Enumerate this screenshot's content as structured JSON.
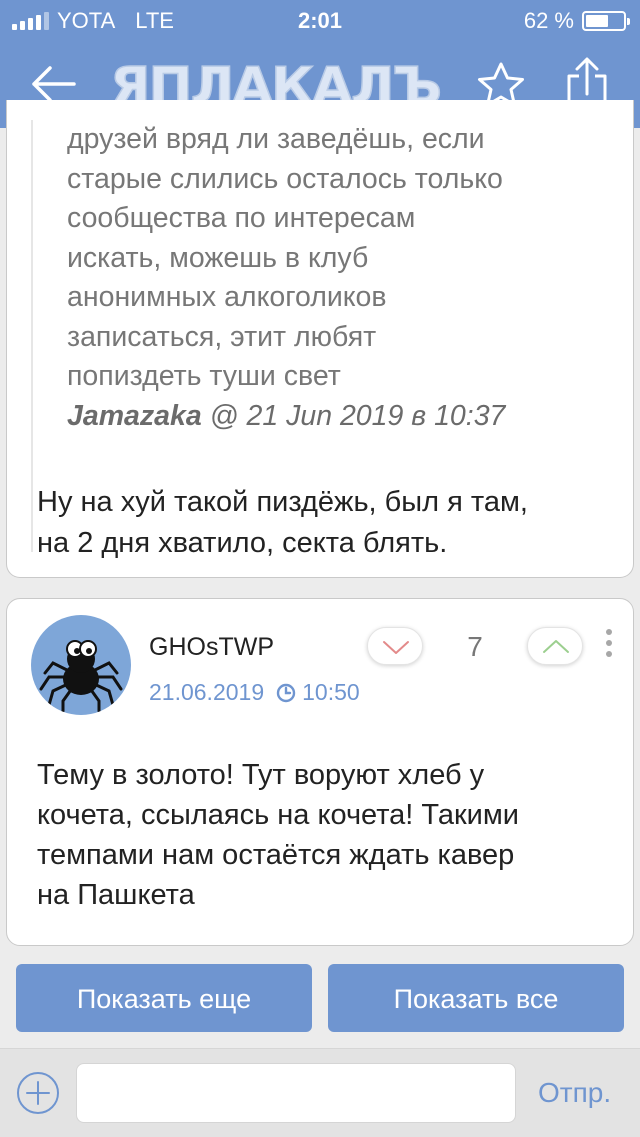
{
  "status_bar": {
    "carrier": "YOTA",
    "network": "LTE",
    "time": "2:01",
    "battery_text": "62 %",
    "battery_level": 0.62
  },
  "nav": {
    "logo_text": "ЯПЛАКАЛЪ",
    "icons": [
      "back-arrow-icon",
      "star-icon",
      "share-icon"
    ]
  },
  "post1": {
    "quote_lines": [
      "друзей вряд ли заведёшь, если",
      "старые слились осталось только",
      "сообщества по интересам",
      "искать, можешь в клуб",
      "анонимных алкоголиков",
      "записаться, этит любят",
      "попиздеть туши свет"
    ],
    "quote_author": "Jamazaka",
    "quote_meta": " @ 21 Jun 2019 в 10:37",
    "reply_lines": [
      "Ну на хуй такой пиздёжь, был я там,",
      "на 2 дня хватило, секта блять."
    ]
  },
  "post2": {
    "username": "GHOsTWP",
    "date": "21.06.2019",
    "time": "10:50",
    "rating": "7",
    "body_lines": [
      "Тему в золото! Тут воруют хлеб у",
      "кочета, ссылаясь на кочета! Такими",
      "темпами нам остаётся ждать кавер",
      "на Пашкета"
    ]
  },
  "buttons": {
    "show_more": "Показать еще",
    "show_all": "Показать все"
  },
  "compose": {
    "placeholder": "",
    "send_label": "Отпр."
  },
  "colors": {
    "accent": "#6f95d0",
    "background": "#ececec",
    "quote_text": "#777777",
    "vote_down": "#e38a8a",
    "vote_up": "#9ccf8f"
  }
}
